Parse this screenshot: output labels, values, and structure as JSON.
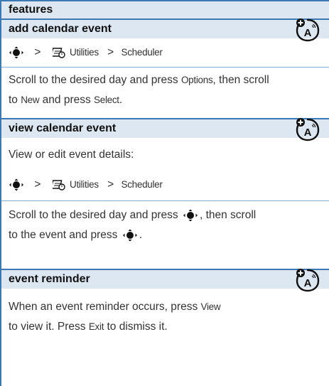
{
  "header": {
    "title": "features"
  },
  "sections": [
    {
      "title": "add calendar event",
      "path": {
        "sep": ">",
        "item1": "Utilities",
        "sep2": ">",
        "item2": "Scheduler"
      },
      "para1_a": "Scroll to the desired day and press ",
      "para1_kw1": "Options",
      "para1_b": ", then scroll",
      "para2_a": "to ",
      "para2_kw1": "New",
      "para2_b": " and press ",
      "para2_kw2": "Select",
      "para2_c": "."
    },
    {
      "title": "view calendar event",
      "intro": "View or edit event details:",
      "path": {
        "sep": ">",
        "item1": "Utilities",
        "sep2": ">",
        "item2": "Scheduler"
      },
      "para1_a": "Scroll to the desired day and press ",
      "para1_b": ", then scroll",
      "para2_a": "to the event and press ",
      "para2_b": "."
    },
    {
      "title": "event reminder",
      "para1_a": "When an event reminder occurs, press ",
      "para1_kw1": "View",
      "para2_a": "to view it. Press ",
      "para2_kw1": "Exit",
      "para2_b": " to dismiss it."
    }
  ],
  "icons": {
    "nav": "navigation-key-icon",
    "utilities": "utilities-menu-icon",
    "feature": "network-feature-badge-icon"
  },
  "colors": {
    "accent": "#3c78b4",
    "header_bg": "#dde7f2"
  }
}
